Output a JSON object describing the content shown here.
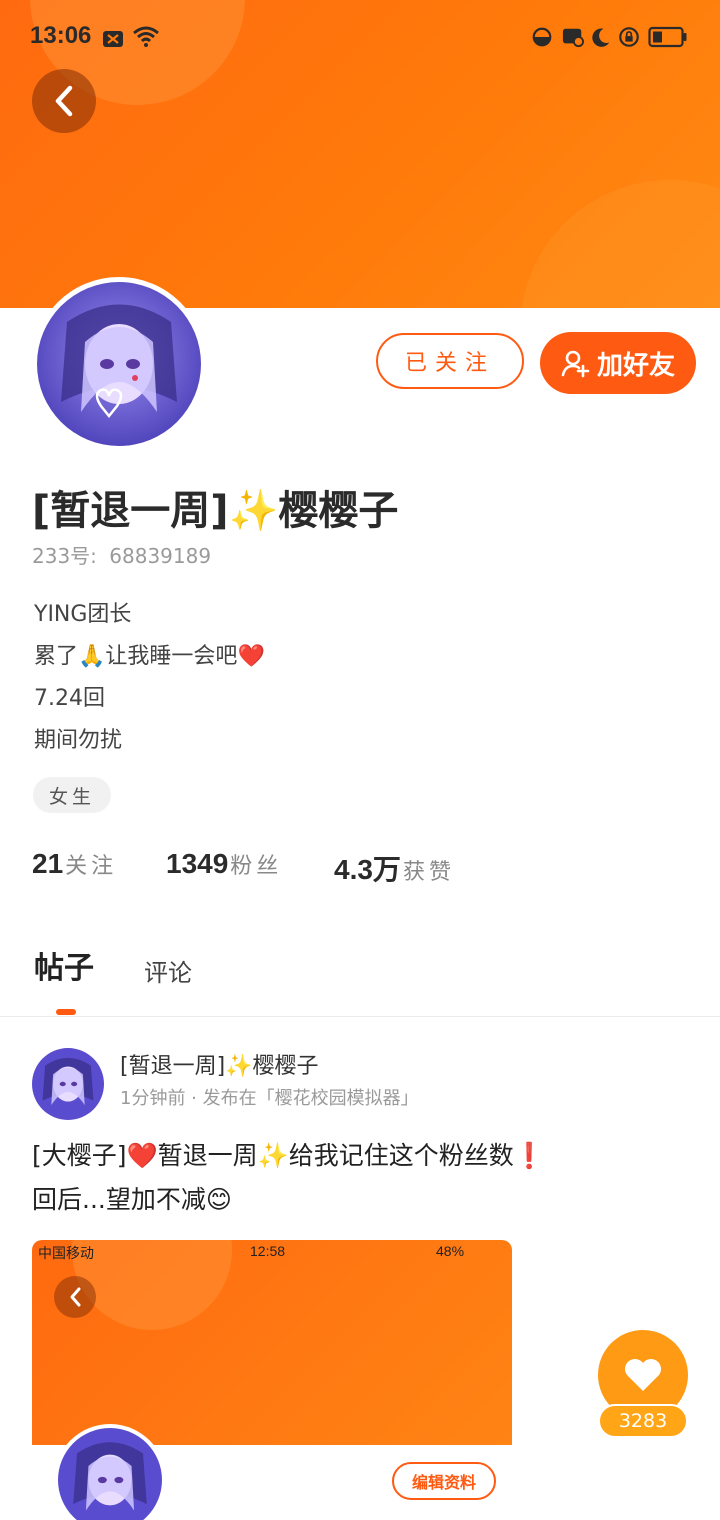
{
  "status_bar": {
    "time": "13:06"
  },
  "icons": {
    "back": "chevron-left-icon",
    "add_friend": "user-plus-icon",
    "like": "heart-icon"
  },
  "colors": {
    "accent": "#ff5a12",
    "banner": "#ff7a0a",
    "like": "#ff9a14"
  },
  "profile": {
    "follow_button": "已关注",
    "add_friend_button": "加好友",
    "name_prefix": "[暂退一周]",
    "name_emoji": "✨",
    "name": "樱樱子",
    "uid_label": "233号:",
    "uid": "68839189",
    "bio": [
      {
        "text": "YING团长",
        "emoji": ""
      },
      {
        "text": "累了",
        "emoji": "🙏",
        "text2": "让我睡一会吧",
        "emoji2": "❤️"
      },
      {
        "text": "7.24回",
        "emoji": ""
      },
      {
        "text": "期间勿扰",
        "emoji": ""
      }
    ],
    "gender": "女生",
    "stats": [
      {
        "value": "21",
        "label": "关注"
      },
      {
        "value": "1349",
        "label": "粉丝"
      },
      {
        "value": "4.3万",
        "label": "获赞"
      }
    ]
  },
  "tabs": [
    {
      "label": "帖子",
      "active": true
    },
    {
      "label": "评论",
      "active": false
    }
  ],
  "post": {
    "author": "[暂退一周]✨樱樱子",
    "meta": "1分钟前 · 发布在「樱花校园模拟器」",
    "text_line1": "[大樱子]❤️暂退一周✨给我记住这个粉丝数❗",
    "text_line2": "回后...望加不减😊",
    "image": {
      "carrier": "中国移动",
      "time": "12:58",
      "battery": "48%",
      "edit_button": "编辑资料"
    },
    "likes": "3283"
  }
}
